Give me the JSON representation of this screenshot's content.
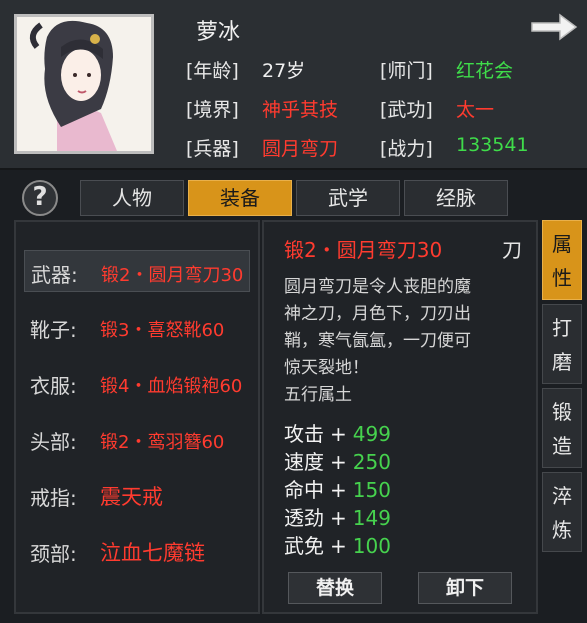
{
  "character": {
    "name": "萝冰",
    "stats": [
      {
        "label": "[年龄]",
        "value": "27岁",
        "color": "#f0f0f0"
      },
      {
        "label": "[师门]",
        "value": "红花会",
        "color": "#3fdc4a"
      },
      {
        "label": "[境界]",
        "value": "神乎其技",
        "color": "#ff3b2f"
      },
      {
        "label": "[武功]",
        "value": "太一",
        "color": "#ff3b2f"
      },
      {
        "label": "[兵器]",
        "value": "圆月弯刀",
        "color": "#ff3b2f"
      },
      {
        "label": "[战力]",
        "value": "133541",
        "color": "#3fdc4a"
      }
    ]
  },
  "help_label": "?",
  "tabs": [
    "人物",
    "装备",
    "武学",
    "经脉"
  ],
  "active_tab": "装备",
  "equipment_slots": [
    {
      "label": "武器:",
      "item": "锻2・圆月弯刀30"
    },
    {
      "label": "靴子:",
      "item": "锻3・喜怒靴60"
    },
    {
      "label": "衣服:",
      "item": "锻4・血焰锻袍60"
    },
    {
      "label": "头部:",
      "item": "锻2・鸾羽簪60"
    },
    {
      "label": "戒指:",
      "item": "震天戒"
    },
    {
      "label": "颈部:",
      "item": "泣血七魔链"
    }
  ],
  "item_detail": {
    "title": "锻2・圆月弯刀30",
    "type": "刀",
    "description": [
      "圆月弯刀是令人丧胆的魔",
      "神之刀，月色下，刀刃出",
      "鞘，寒气氤氲，一刀便可",
      "惊天裂地！",
      "五行属土"
    ],
    "stats": [
      {
        "name": "攻击",
        "value": "499"
      },
      {
        "name": "速度",
        "value": "250"
      },
      {
        "name": "命中",
        "value": "150"
      },
      {
        "name": "透劲",
        "value": "149"
      },
      {
        "name": "武免",
        "value": "100"
      }
    ],
    "actions": {
      "replace": "替换",
      "unequip": "卸下"
    }
  },
  "side_tabs": [
    {
      "chars": [
        "属",
        "性"
      ],
      "active": true
    },
    {
      "chars": [
        "打",
        "磨"
      ],
      "active": false
    },
    {
      "chars": [
        "锻",
        "造"
      ],
      "active": false
    },
    {
      "chars": [
        "淬",
        "炼"
      ],
      "active": false
    }
  ],
  "colors": {
    "accent": "#d8941a",
    "red": "#ff3b2f",
    "green": "#3fdc4a"
  }
}
